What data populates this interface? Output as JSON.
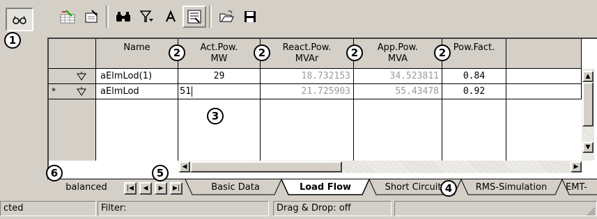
{
  "toolbar": {
    "icons": [
      "glasses-icon",
      "edit-grid-icon",
      "edit-sheet-icon",
      "find-icon",
      "filter-icon",
      "font-icon",
      "detail-view-icon",
      "open-folder-icon",
      "save-icon"
    ]
  },
  "callouts": [
    "1",
    "2",
    "2",
    "2",
    "2",
    "3",
    "4",
    "5",
    "6"
  ],
  "table": {
    "columns": [
      {
        "name_line1": "Name",
        "name_line2": ""
      },
      {
        "name_line1": "Act.Pow.",
        "name_line2": "MW"
      },
      {
        "name_line1": "React.Pow.",
        "name_line2": "MVAr"
      },
      {
        "name_line1": "App.Pow.",
        "name_line2": "MVA"
      },
      {
        "name_line1": "Pow.Fact.",
        "name_line2": ""
      }
    ],
    "rows": [
      {
        "marker": "",
        "name": "aElmLod(1)",
        "act_pow": "29",
        "react_pow": "18.732153",
        "app_pow": "34.523811",
        "pow_fact": "0.84"
      },
      {
        "marker": "*",
        "name": "aElmLod",
        "act_pow": "51",
        "react_pow": "21.725903",
        "app_pow": "55.43478",
        "pow_fact": "0.92"
      }
    ]
  },
  "tabs": {
    "left_label": "balanced",
    "items": [
      "Basic Data",
      "Load Flow",
      "Short Circuit",
      "RMS-Simulation",
      "EMT-"
    ],
    "active": "Load Flow"
  },
  "status": {
    "left": "cted",
    "filter": "Filter:",
    "drag_drop": "Drag & Drop: off"
  }
}
